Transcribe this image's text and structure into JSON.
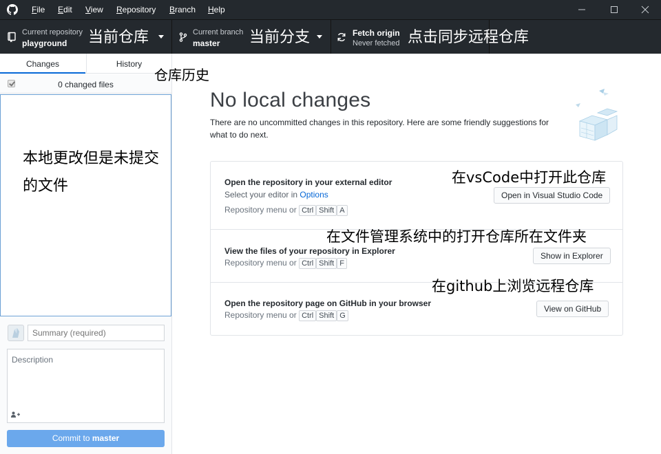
{
  "menu": {
    "items": [
      {
        "accel": "F",
        "rest": "ile"
      },
      {
        "accel": "E",
        "rest": "dit"
      },
      {
        "accel": "V",
        "rest": "iew"
      },
      {
        "accel": "R",
        "rest": "epository"
      },
      {
        "accel": "B",
        "rest": "ranch"
      },
      {
        "accel": "H",
        "rest": "elp"
      }
    ]
  },
  "toolbar": {
    "repo": {
      "label": "Current repository",
      "value": "playground",
      "note": "当前仓库"
    },
    "branch": {
      "label": "Current branch",
      "value": "master",
      "note": "当前分支"
    },
    "fetch": {
      "label": "Fetch origin",
      "status": "Never fetched",
      "note": "点击同步远程仓库"
    }
  },
  "sidebar": {
    "tabs": [
      "Changes",
      "History"
    ],
    "history_note": "仓库历史",
    "changed_files": "0 changed files",
    "file_list_note": "本地更改但是未提交的文件",
    "summary_placeholder": "Summary (required)",
    "description_placeholder": "Description",
    "commit_prefix": "Commit to ",
    "commit_branch": "master"
  },
  "main": {
    "heading": "No local changes",
    "subtext": "There are no uncommitted changes in this repository. Here are some friendly suggestions for what to do next.",
    "actions": [
      {
        "title": "Open the repository in your external editor",
        "sub_prefix": "Select your editor in ",
        "sub_link": "Options",
        "menu_prefix": "Repository menu or",
        "keys": [
          "Ctrl",
          "Shift",
          "A"
        ],
        "button": "Open in Visual Studio Code",
        "note": "在vsCode中打开此仓库"
      },
      {
        "title": "View the files of your repository in Explorer",
        "menu_prefix": "Repository menu or",
        "keys": [
          "Ctrl",
          "Shift",
          "F"
        ],
        "button": "Show in Explorer",
        "note": "在文件管理系统中的打开仓库所在文件夹"
      },
      {
        "title": "Open the repository page on GitHub in your browser",
        "menu_prefix": "Repository menu or",
        "keys": [
          "Ctrl",
          "Shift",
          "G"
        ],
        "button": "View on GitHub",
        "note": "在github上浏览远程仓库"
      }
    ]
  },
  "colors": {
    "titlebar": "#24292e",
    "accent": "#0366d6",
    "commit_button": "#6ba8ec"
  },
  "icons": [
    "github-logo-icon",
    "minimize-icon",
    "maximize-icon",
    "close-icon",
    "repo-icon",
    "branch-icon",
    "sync-icon",
    "caret-down-icon",
    "checkbox-icon",
    "avatar-icon",
    "add-coauthor-icon"
  ]
}
